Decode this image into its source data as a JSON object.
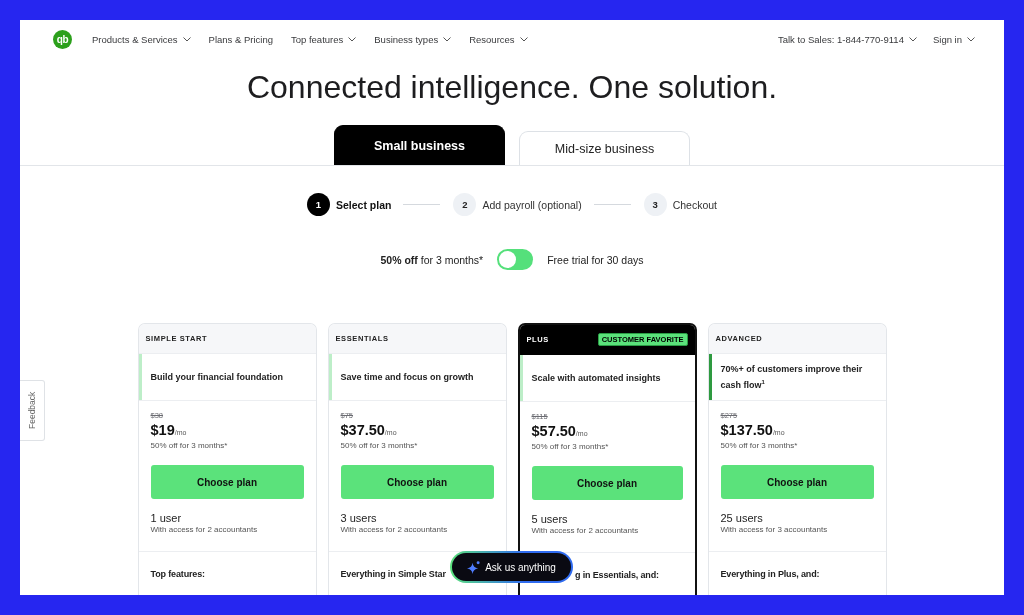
{
  "nav": {
    "logo": "qb",
    "links": [
      {
        "label": "Products & Services",
        "dropdown": true
      },
      {
        "label": "Plans & Pricing",
        "dropdown": false
      },
      {
        "label": "Top features",
        "dropdown": true
      },
      {
        "label": "Business types",
        "dropdown": true
      },
      {
        "label": "Resources",
        "dropdown": true
      }
    ],
    "right_links": [
      {
        "label": "Talk to Sales: 1-844-770-9114",
        "dropdown": true
      },
      {
        "label": "Sign in",
        "dropdown": true
      }
    ]
  },
  "heading": "Connected intelligence. One solution.",
  "tabs": [
    {
      "label": "Small business",
      "selected": true
    },
    {
      "label": "Mid-size business",
      "selected": false
    }
  ],
  "steps": [
    {
      "number": "1",
      "label": "Select plan",
      "selected": true
    },
    {
      "number": "2",
      "label": "Add payroll (optional)",
      "selected": false
    },
    {
      "number": "3",
      "label": "Checkout",
      "selected": false
    }
  ],
  "billing_toggle": {
    "left_label": "**50% off** for 3 months*",
    "on": false,
    "right_label": "Free trial for 30 days"
  },
  "plans": [
    {
      "name": "SIMPLE START",
      "featured": false,
      "color": "#bdeec8",
      "tagline": "Build your financial foundation",
      "old_price": "$38",
      "price": "$19",
      "period": "/mo",
      "discount_note": "50% off for 3 months*",
      "button": "Choose plan",
      "users": "1 user",
      "accountants": "With access for 2 accountants",
      "features_heading": "Top features:"
    },
    {
      "name": "ESSENTIALS",
      "featured": false,
      "color": "#bdeec8",
      "tagline": "Save time and focus on growth",
      "old_price": "$75",
      "price": "$37.50",
      "period": "/mo",
      "discount_note": "50% off for 3 months*",
      "button": "Choose plan",
      "users": "3 users",
      "accountants": "With access for 2 accountants",
      "features_heading": "Everything in Simple Star"
    },
    {
      "name": "PLUS",
      "badge": "CUSTOMER FAVORITE",
      "featured": true,
      "color": "#bdeec8",
      "tagline": "Scale with automated insights",
      "old_price": "$115",
      "price": "$57.50",
      "period": "/mo",
      "discount_note": "50% off for 3 months*",
      "button": "Choose plan",
      "users": "5 users",
      "accountants": "With access for 2 accountants",
      "features_heading": "g in Essentials, and:"
    },
    {
      "name": "ADVANCED",
      "featured": false,
      "color": "#2e9a40",
      "tagline": "70%+ of customers improve their cash flow$^{1}$",
      "old_price": "$275",
      "price": "$137.50",
      "period": "/mo",
      "discount_note": "50% off for 3 months*",
      "button": "Choose plan",
      "users": "25 users",
      "accountants": "With access for 3 accountants",
      "features_heading": "Everything in Plus, and:"
    }
  ],
  "ask_button": {
    "label": "Ask us anything"
  },
  "feedback_tab": {
    "label": "Feedback"
  }
}
